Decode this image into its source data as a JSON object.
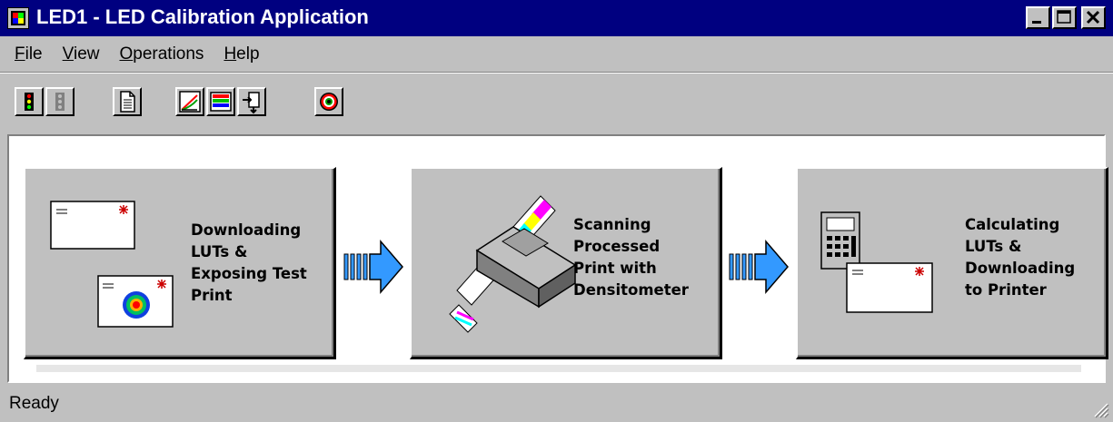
{
  "window": {
    "title": "LED1 - LED Calibration Application",
    "controls": [
      "minimize",
      "maximize",
      "close"
    ]
  },
  "menu": {
    "items": [
      {
        "label": "File",
        "mnemonic": "F",
        "rest": "ile"
      },
      {
        "label": "View",
        "mnemonic": "V",
        "rest": "iew"
      },
      {
        "label": "Operations",
        "mnemonic": "O",
        "rest": "perations"
      },
      {
        "label": "Help",
        "mnemonic": "H",
        "rest": "elp"
      }
    ]
  },
  "toolbar": {
    "buttons": [
      {
        "icon": "traffic-light-icon"
      },
      {
        "icon": "traffic-light-disabled-icon"
      },
      {
        "icon": "document-icon"
      },
      {
        "icon": "graph-icon"
      },
      {
        "icon": "color-table-icon"
      },
      {
        "icon": "download-icon"
      },
      {
        "icon": "target-icon"
      }
    ]
  },
  "steps": [
    {
      "label": "Downloading\nLUTs &\nExposing Test\nPrint",
      "icon": "test-print-icon"
    },
    {
      "label": "Scanning\nProcessed\nPrint with\nDensitometer",
      "icon": "densitometer-icon"
    },
    {
      "label": "Calculating\nLUTs &\nDownloading\nto Printer",
      "icon": "calculator-printer-icon"
    }
  ],
  "status": {
    "text": "Ready"
  },
  "colors": {
    "title_bar": "#000080",
    "arrow_blue": "#3399ff",
    "face": "#c0c0c0"
  }
}
